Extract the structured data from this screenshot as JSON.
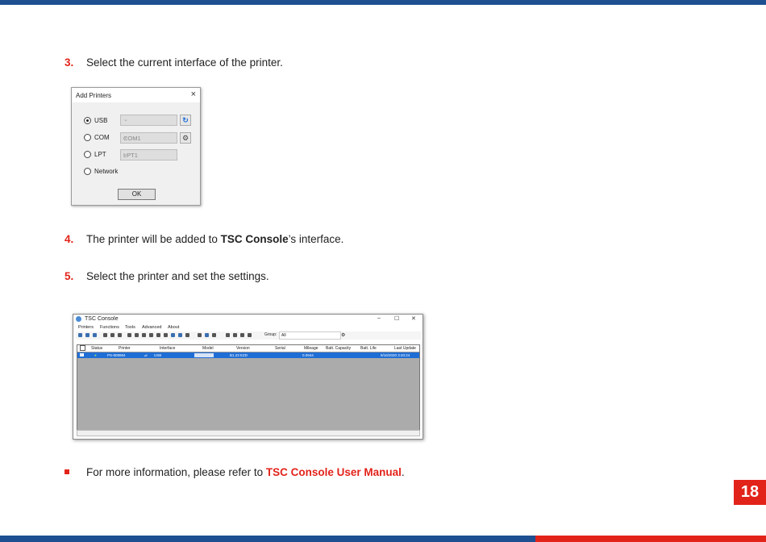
{
  "steps": [
    {
      "num": "3.",
      "text": "Select the current interface of the printer."
    },
    {
      "num": "4.",
      "text_before": "The printer will be added to ",
      "bold": "TSC Console",
      "text_after": "’s interface."
    },
    {
      "num": "5.",
      "text": "Select the printer and set the settings."
    }
  ],
  "note": {
    "text_before": "For more information, please refer to ",
    "link": "TSC Console User Manual",
    "text_after": "."
  },
  "page_number": "18",
  "dialog": {
    "title": "Add Printers",
    "close": "×",
    "options": [
      {
        "label": "USB",
        "selected": true,
        "combo": "",
        "button_icon": "refresh-icon"
      },
      {
        "label": "COM",
        "selected": false,
        "combo": "COM1",
        "button_icon": "gear-icon"
      },
      {
        "label": "LPT",
        "selected": false,
        "combo": "LPT1"
      },
      {
        "label": "Network",
        "selected": false
      }
    ],
    "ok": "OK"
  },
  "console": {
    "title": "TSC Console",
    "controls": [
      "–",
      "☐",
      "✕"
    ],
    "menu": [
      "Printers",
      "Functions",
      "Tools",
      "Advanced",
      "About"
    ],
    "group_label": "Group:",
    "group_value": "All",
    "columns": [
      "Status",
      "Printer",
      "Interface",
      "Model",
      "Version",
      "Serial",
      "Mileage",
      "Batt. Capacity",
      "Batt. Life",
      "Last Update"
    ],
    "row": {
      "printer": "PS-808984",
      "interface": "USB",
      "model": "",
      "version": "B1.23 EZD",
      "serial": "",
      "mileage": "0.0944",
      "last_update": "9/16/2020 3:40:24"
    }
  },
  "colors": {
    "accent_red": "#e2231a",
    "brand_blue": "#1d4f91",
    "selection_blue": "#1f6ed6"
  }
}
